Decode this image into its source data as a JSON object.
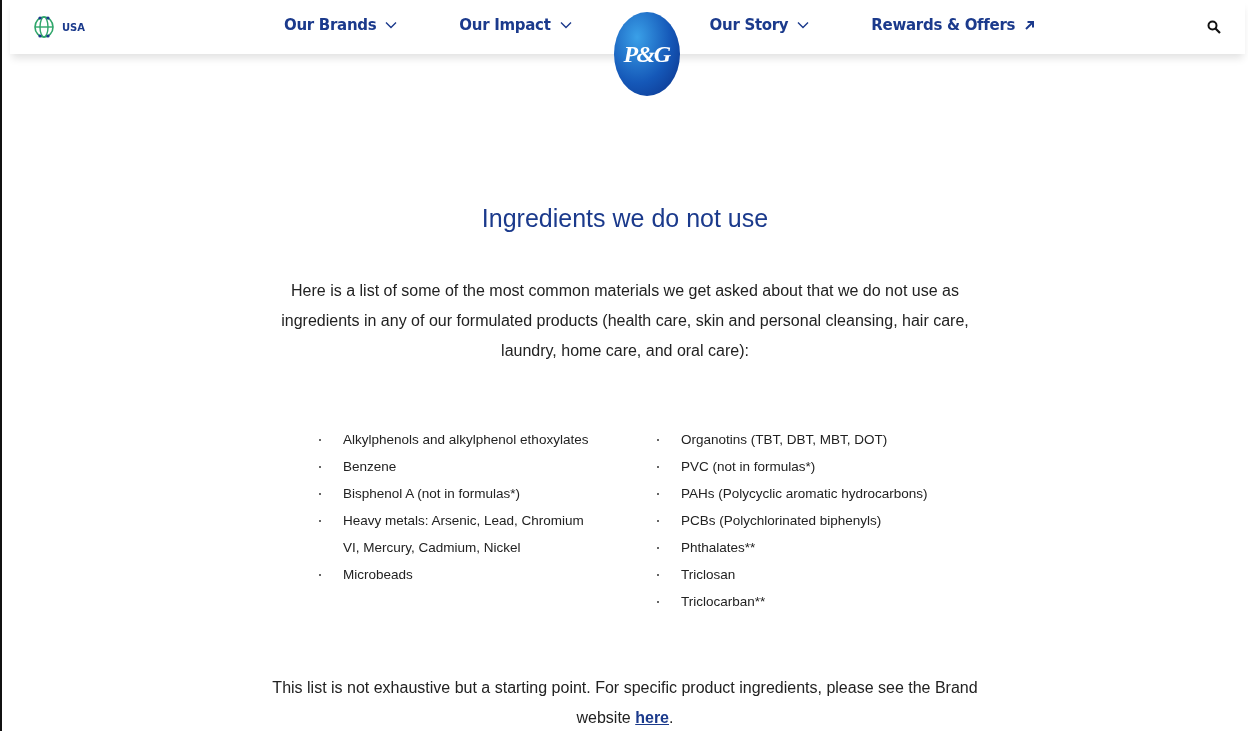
{
  "header": {
    "region": "USA",
    "nav": [
      {
        "label": "Our Brands",
        "kind": "dropdown"
      },
      {
        "label": "Our Impact",
        "kind": "dropdown"
      },
      {
        "label": "Our Story",
        "kind": "dropdown"
      },
      {
        "label": "Rewards & Offers",
        "kind": "external"
      }
    ],
    "logo": "P&G"
  },
  "title": "Ingredients we do not use",
  "intro": "Here is a list of some of the most common materials we get asked about that we do not use as ingredients in any of our formulated products (health care, skin and personal cleansing, hair care, laundry, home care, and oral care):",
  "lists": [
    [
      "Alkylphenols and alkylphenol ethoxylates",
      "Benzene",
      "Bisphenol A (not in formulas*)",
      "Heavy metals: Arsenic, Lead, Chromium VI, Mercury, Cadmium, Nickel",
      "Microbeads"
    ],
    [
      "Organotins (TBT, DBT, MBT, DOT)",
      "PVC (not in formulas*)",
      "PAHs (Polycyclic aromatic hydrocarbons)",
      "PCBs (Polychlorinated biphenyls)",
      "Phthalates**",
      "Triclosan",
      "Triclocarban**"
    ]
  ],
  "footer": {
    "text": "This list is not exhaustive but a starting point. For specific product ingredients, please see the Brand website",
    "link": "here",
    "after": "."
  }
}
